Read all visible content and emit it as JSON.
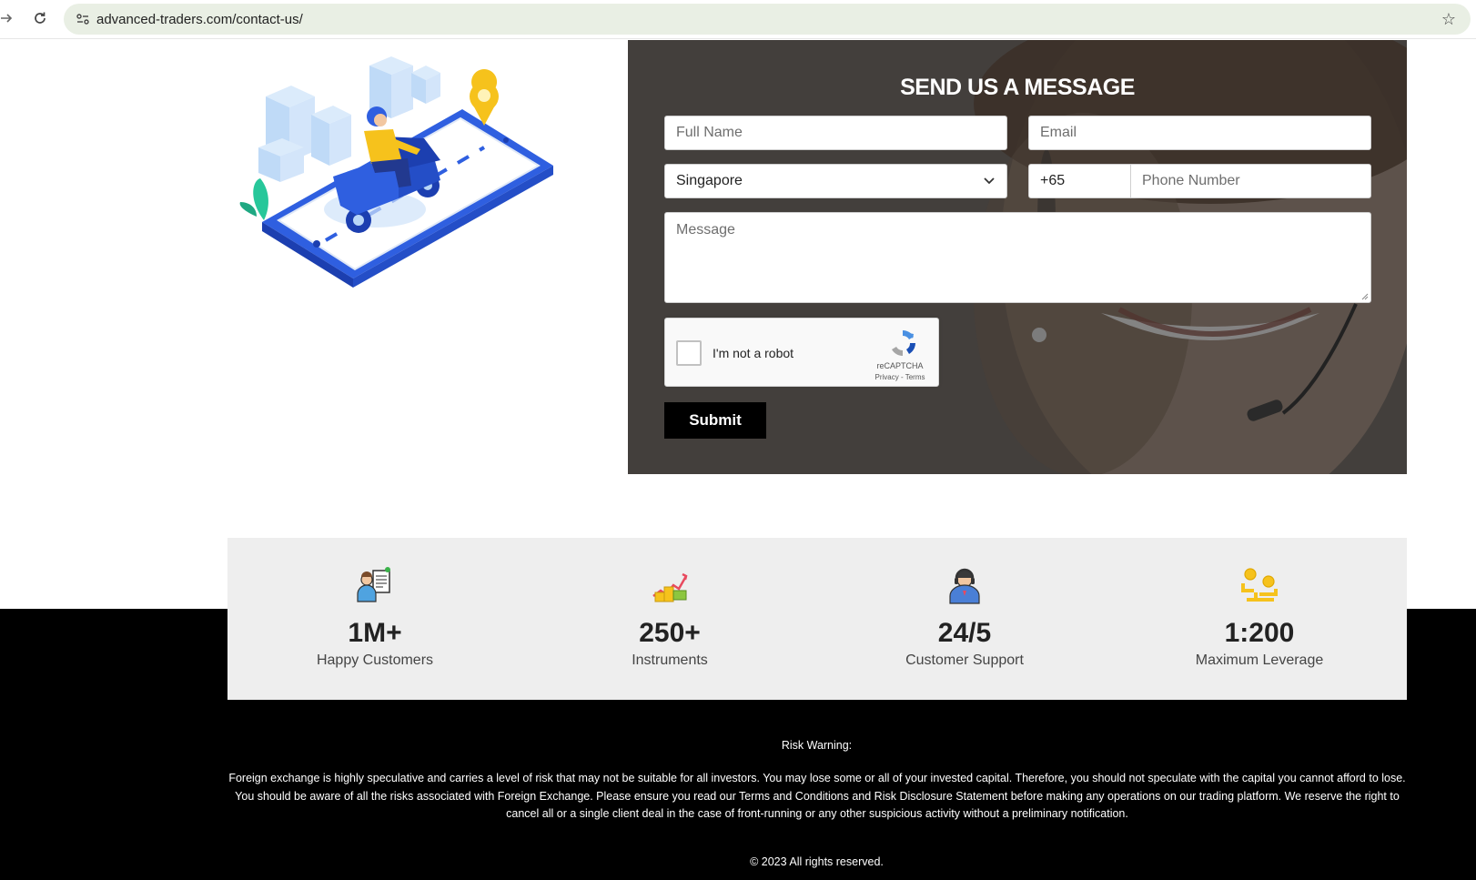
{
  "browser": {
    "url": "advanced-traders.com/contact-us/"
  },
  "contact": {
    "title": "SEND US A MESSAGE",
    "full_name_placeholder": "Full Name",
    "email_placeholder": "Email",
    "country_value": "Singapore",
    "dial_code": "+65",
    "phone_placeholder": "Phone Number",
    "message_placeholder": "Message",
    "recaptcha_label": "I'm not a robot",
    "recaptcha_brand": "reCAPTCHA",
    "recaptcha_links": "Privacy - Terms",
    "submit_label": "Submit"
  },
  "stats": [
    {
      "value": "1M+",
      "label": "Happy Customers",
      "icon": "customer-list-icon"
    },
    {
      "value": "250+",
      "label": "Instruments",
      "icon": "growth-chart-icon"
    },
    {
      "value": "24/5",
      "label": "Customer Support",
      "icon": "support-agent-icon"
    },
    {
      "value": "1:200",
      "label": "Maximum Leverage",
      "icon": "leverage-coins-icon"
    }
  ],
  "footer": {
    "risk_title": "Risk Warning:",
    "risk_text": "Foreign exchange is highly speculative and carries a level of risk that may not be suitable for all investors. You may lose some or all of your invested capital. Therefore, you should not speculate with the capital you cannot afford to lose. You should be aware of all the risks associated with Foreign Exchange. Please ensure you read our Terms and Conditions and Risk Disclosure Statement before making any operations on our trading platform. We reserve the right to cancel all or a single client deal in the case of front-running or any other suspicious activity without a preliminary notification.",
    "copyright": "© 2023 All rights reserved."
  },
  "colors": {
    "brand_blue": "#2f5fe0",
    "footer_bg": "#000000",
    "stats_bg": "#eeeeee"
  }
}
